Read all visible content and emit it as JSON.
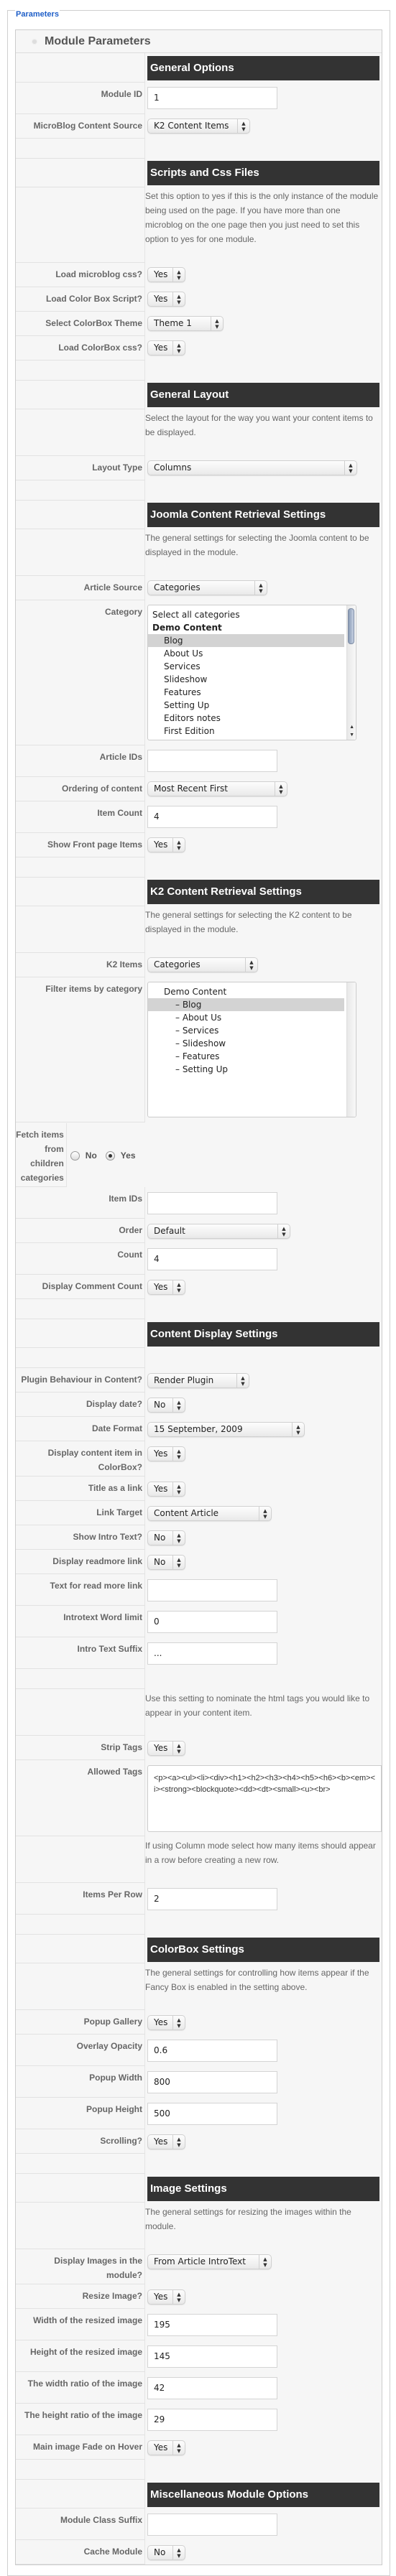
{
  "legend": "Parameters",
  "panel_title": "Module Parameters",
  "rows": [
    {
      "type": "header",
      "text": "General Options"
    },
    {
      "type": "input",
      "label": "Module ID",
      "value": "1"
    },
    {
      "type": "select",
      "label": "MicroBlog Content Source",
      "value": "K2 Content Items"
    },
    {
      "type": "spacer"
    },
    {
      "type": "header",
      "text": "Scripts and Css Files"
    },
    {
      "type": "desc",
      "text": "Set this option to yes if this is the only instance of the module being used on the page. If you have more than one microblog on the one page then you just need to set this option to yes for one module."
    },
    {
      "type": "select",
      "label": "Load microblog css?",
      "value": "Yes"
    },
    {
      "type": "select",
      "label": "Load Color Box Script?",
      "value": "Yes"
    },
    {
      "type": "select",
      "label": "Select ColorBox Theme",
      "value": "Theme 1"
    },
    {
      "type": "select",
      "label": "Load ColorBox css?",
      "value": "Yes"
    },
    {
      "type": "spacer"
    },
    {
      "type": "header",
      "text": "General Layout"
    },
    {
      "type": "desc",
      "text": "Select the layout for the way you want your content items to be displayed."
    },
    {
      "type": "select",
      "label": "Layout Type",
      "value": "Columns"
    },
    {
      "type": "spacer"
    },
    {
      "type": "header",
      "text": "Joomla Content Retrieval Settings"
    },
    {
      "type": "desc",
      "text": "The general settings for selecting the Joomla content to be displayed in the module."
    },
    {
      "type": "select",
      "label": "Article Source",
      "value": "Categories"
    },
    {
      "type": "listbox",
      "label": "Category",
      "scrollbar": true,
      "options": [
        {
          "text": "Select all categories",
          "level": 0
        },
        {
          "text": "Demo Content",
          "level": 0,
          "bold": true
        },
        {
          "text": "Blog",
          "level": 1,
          "selected": true
        },
        {
          "text": "About Us",
          "level": 1
        },
        {
          "text": "Services",
          "level": 1
        },
        {
          "text": "Slideshow",
          "level": 1
        },
        {
          "text": "Features",
          "level": 1
        },
        {
          "text": "Setting Up",
          "level": 1
        },
        {
          "text": "Editors notes",
          "level": 1
        },
        {
          "text": "First Edition",
          "level": 1
        }
      ]
    },
    {
      "type": "input",
      "label": "Article IDs",
      "value": ""
    },
    {
      "type": "select",
      "label": "Ordering of content",
      "value": "Most Recent First"
    },
    {
      "type": "input",
      "label": "Item Count",
      "value": "4"
    },
    {
      "type": "select",
      "label": "Show Front page Items",
      "value": "Yes"
    },
    {
      "type": "spacer"
    },
    {
      "type": "header",
      "text": "K2 Content Retrieval Settings"
    },
    {
      "type": "desc",
      "text": "The general settings for selecting the K2 content to be displayed in the module."
    },
    {
      "type": "select",
      "label": "K2 Items",
      "value": "Categories"
    },
    {
      "type": "listbox",
      "label": "Filter items by category",
      "scrollbar": false,
      "options": [
        {
          "text": "Demo Content",
          "level": 1
        },
        {
          "text": "– Blog",
          "level": 2,
          "selected": true
        },
        {
          "text": "– About Us",
          "level": 2
        },
        {
          "text": "– Services",
          "level": 2
        },
        {
          "text": "– Slideshow",
          "level": 2
        },
        {
          "text": "– Features",
          "level": 2
        },
        {
          "text": "– Setting Up",
          "level": 2
        }
      ]
    },
    {
      "type": "radio",
      "label": "Fetch items from children categories",
      "options": [
        {
          "text": "No",
          "checked": false
        },
        {
          "text": "Yes",
          "checked": true
        }
      ]
    },
    {
      "type": "input",
      "label": "Item IDs",
      "value": ""
    },
    {
      "type": "select",
      "label": "Order",
      "value": "Default"
    },
    {
      "type": "input",
      "label": "Count",
      "value": "4"
    },
    {
      "type": "select",
      "label": "Display Comment Count",
      "value": "Yes"
    },
    {
      "type": "spacer"
    },
    {
      "type": "header",
      "text": "Content Display Settings"
    },
    {
      "type": "spacer"
    },
    {
      "type": "select",
      "label": "Plugin Behaviour in Content?",
      "value": "Render Plugin"
    },
    {
      "type": "select",
      "label": "Display date?",
      "value": "No"
    },
    {
      "type": "select",
      "label": "Date Format",
      "value": "15 September, 2009"
    },
    {
      "type": "select",
      "label": "Display content item in ColorBox?",
      "value": "Yes"
    },
    {
      "type": "select",
      "label": "Title as a link",
      "value": "Yes"
    },
    {
      "type": "select",
      "label": "Link Target",
      "value": "Content Article"
    },
    {
      "type": "select",
      "label": "Show Intro Text?",
      "value": "No"
    },
    {
      "type": "select",
      "label": "Display readmore link",
      "value": "No"
    },
    {
      "type": "input",
      "label": "Text for read more link",
      "value": ""
    },
    {
      "type": "input",
      "label": "Introtext Word limit",
      "value": "0"
    },
    {
      "type": "input",
      "label": "Intro Text Suffix",
      "value": "..."
    },
    {
      "type": "spacer"
    },
    {
      "type": "desc",
      "text": "Use this setting to nominate the html tags you would like to appear in your content item."
    },
    {
      "type": "select",
      "label": "Strip Tags",
      "value": "Yes"
    },
    {
      "type": "textarea",
      "label": "Allowed Tags",
      "value": "<p><a><ul><li><div><h1><h2><h3><h4><h5><h6><b><em><i><strong><blockquote><dd><dt><small><u><br>"
    },
    {
      "type": "desc",
      "text": "If using Column mode select how many items should appear in a row before creating a new row."
    },
    {
      "type": "input",
      "label": "Items Per Row",
      "value": "2"
    },
    {
      "type": "spacer"
    },
    {
      "type": "header",
      "text": "ColorBox Settings"
    },
    {
      "type": "desc",
      "text": "The general settings for controlling how items appear if the Fancy Box is enabled in the setting above."
    },
    {
      "type": "select",
      "label": "Popup Gallery",
      "value": "Yes"
    },
    {
      "type": "input",
      "label": "Overlay Opacity",
      "value": "0.6"
    },
    {
      "type": "input",
      "label": "Popup Width",
      "value": "800"
    },
    {
      "type": "input",
      "label": "Popup Height",
      "value": "500"
    },
    {
      "type": "select",
      "label": "Scrolling?",
      "value": "Yes"
    },
    {
      "type": "spacer"
    },
    {
      "type": "header",
      "text": "Image Settings"
    },
    {
      "type": "desc",
      "text": "The general settings for resizing the images within the module."
    },
    {
      "type": "select",
      "label": "Display Images in the module?",
      "value": "From Article IntroText"
    },
    {
      "type": "select",
      "label": "Resize Image?",
      "value": "Yes"
    },
    {
      "type": "input",
      "label": "Width of the resized image",
      "value": "195"
    },
    {
      "type": "input",
      "label": "Height of the resized image",
      "value": "145"
    },
    {
      "type": "input",
      "label": "The width ratio of the image",
      "value": "42"
    },
    {
      "type": "input",
      "label": "The height ratio of the image",
      "value": "29"
    },
    {
      "type": "select",
      "label": "Main image Fade on Hover",
      "value": "Yes"
    },
    {
      "type": "spacer"
    },
    {
      "type": "header",
      "text": "Miscellaneous Module Options"
    },
    {
      "type": "input",
      "label": "Module Class Suffix",
      "value": ""
    },
    {
      "type": "select",
      "label": "Cache Module",
      "value": "No"
    }
  ],
  "colors": {
    "header_bg": "#333333",
    "header_text": "#ffffff",
    "legend": "#1f5fc8",
    "panel_bg": "#f6f6f6",
    "label": "#666666"
  }
}
